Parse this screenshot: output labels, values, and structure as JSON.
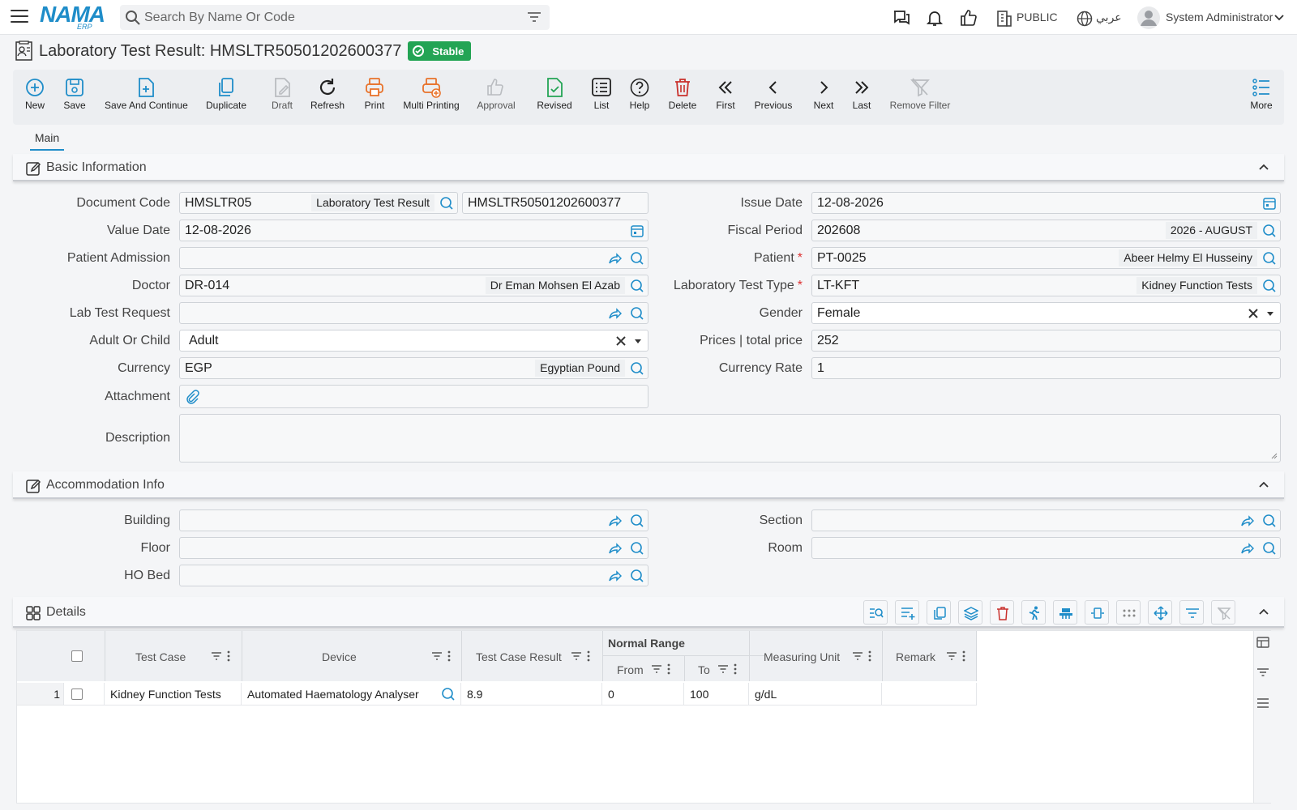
{
  "header": {
    "logo_text": "NAMA",
    "logo_sub": "ERP",
    "search_placeholder": "Search By Name Or Code",
    "branch": "PUBLIC",
    "language": "عربي",
    "user": "System Administrator"
  },
  "page": {
    "title": "Laboratory Test Result: HMSLTR50501202600377",
    "status": "Stable"
  },
  "toolbar": {
    "new": "New",
    "save": "Save",
    "save_continue": "Save And Continue",
    "duplicate": "Duplicate",
    "draft": "Draft",
    "refresh": "Refresh",
    "print": "Print",
    "multi_printing": "Multi Printing",
    "approval": "Approval",
    "revised": "Revised",
    "list": "List",
    "help": "Help",
    "delete": "Delete",
    "first": "First",
    "previous": "Previous",
    "next": "Next",
    "last": "Last",
    "remove_filter": "Remove Filter",
    "more": "More"
  },
  "tabs": {
    "main": "Main"
  },
  "basic": {
    "title": "Basic Information",
    "document_code_label": "Document Code",
    "document_code": "HMSLTR05",
    "document_code_tag": "Laboratory Test Result",
    "document_number": "HMSLTR50501202600377",
    "issue_date_label": "Issue Date",
    "issue_date": "12-08-2026",
    "value_date_label": "Value Date",
    "value_date": "12-08-2026",
    "fiscal_period_label": "Fiscal Period",
    "fiscal_period": "202608",
    "fiscal_period_tag": "2026 - AUGUST",
    "patient_admission_label": "Patient Admission",
    "patient_label": "Patient",
    "patient": "PT-0025",
    "patient_tag": "Abeer Helmy El Husseiny",
    "doctor_label": "Doctor",
    "doctor": "DR-014",
    "doctor_tag": "Dr Eman Mohsen El Azab",
    "lab_test_type_label": "Laboratory Test Type",
    "lab_test_type": "LT-KFT",
    "lab_test_type_tag": "Kidney Function Tests",
    "lab_test_request_label": "Lab Test Request",
    "gender_label": "Gender",
    "gender": "Female",
    "adult_child_label": "Adult Or Child",
    "adult_child": "Adult",
    "prices_label": "Prices | total price",
    "prices": "252",
    "currency_label": "Currency",
    "currency": "EGP",
    "currency_tag": "Egyptian Pound",
    "currency_rate_label": "Currency Rate",
    "currency_rate": "1",
    "attachment_label": "Attachment",
    "description_label": "Description"
  },
  "accommodation": {
    "title": "Accommodation Info",
    "building_label": "Building",
    "section_label": "Section",
    "floor_label": "Floor",
    "room_label": "Room",
    "bed_label": "HO Bed"
  },
  "details": {
    "title": "Details",
    "columns": {
      "test_case": "Test Case",
      "device": "Device",
      "test_case_result": "Test Case Result",
      "normal_range": "Normal Range",
      "from": "From",
      "to": "To",
      "measuring_unit": "Measuring Unit",
      "remark": "Remark"
    },
    "rows": [
      {
        "num": "1",
        "test_case": "Kidney Function Tests",
        "device": "Automated Haematology Analyser",
        "result": "8.9",
        "from": "0",
        "to": "100",
        "unit": "g/dL",
        "remark": ""
      }
    ]
  },
  "colors": {
    "accent": "#1f8dc9",
    "success": "#23a454",
    "danger": "#c9302c",
    "print": "#e8722a"
  }
}
